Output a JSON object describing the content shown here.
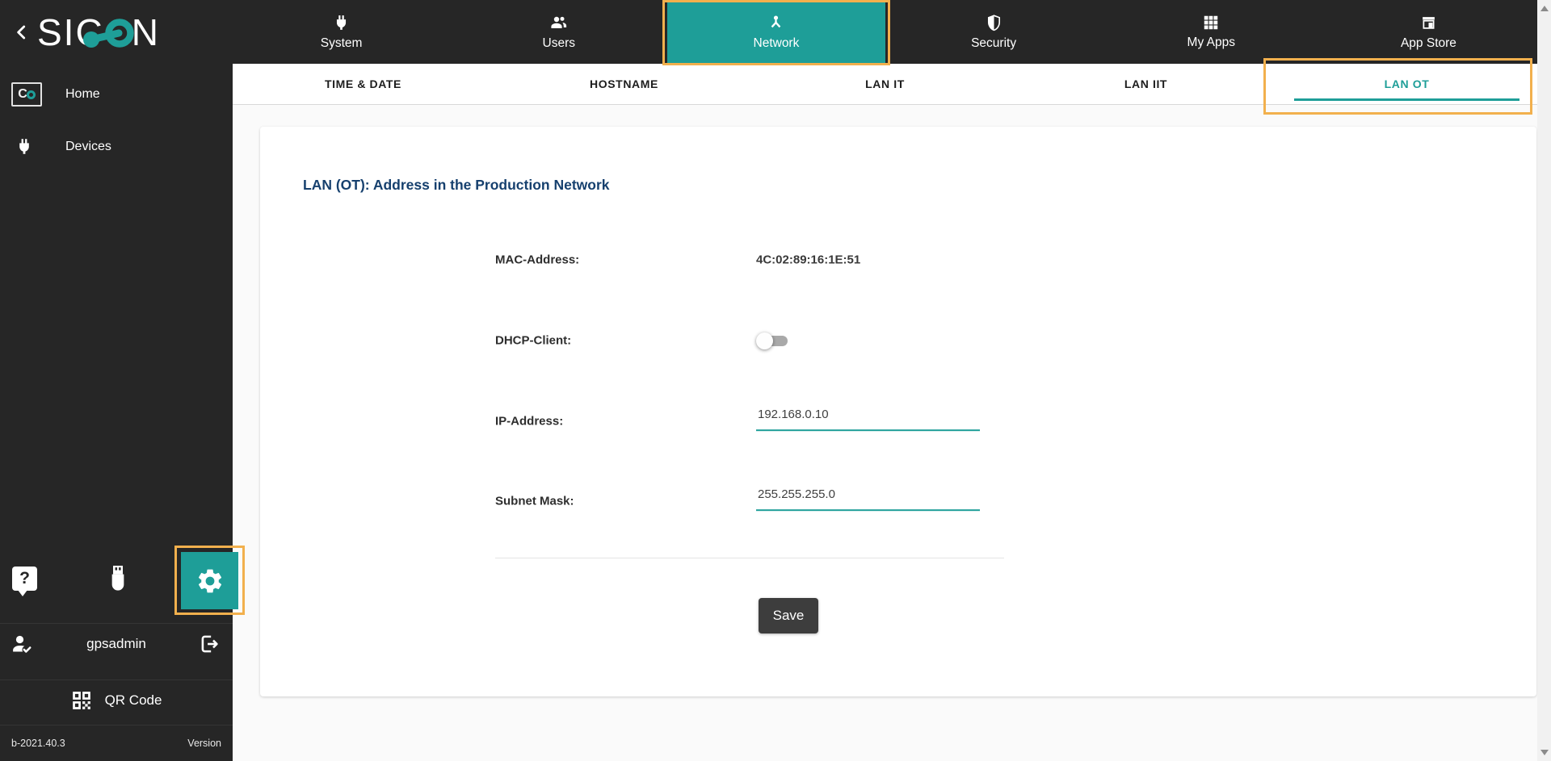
{
  "app": {
    "logo_prefix": "SIC",
    "logo_suffix": "N"
  },
  "topnav": {
    "items": [
      {
        "label": "System",
        "icon": "plug-icon",
        "active": false
      },
      {
        "label": "Users",
        "icon": "users-icon",
        "active": false
      },
      {
        "label": "Network",
        "icon": "network-icon",
        "active": true
      },
      {
        "label": "Security",
        "icon": "shield-icon",
        "active": false
      },
      {
        "label": "My Apps",
        "icon": "grid-icon",
        "active": false
      },
      {
        "label": "App Store",
        "icon": "store-icon",
        "active": false
      }
    ]
  },
  "subnav": {
    "tabs": [
      {
        "label": "TIME & DATE",
        "active": false
      },
      {
        "label": "HOSTNAME",
        "active": false
      },
      {
        "label": "LAN IT",
        "active": false
      },
      {
        "label": "LAN IIT",
        "active": false
      },
      {
        "label": "LAN OT",
        "active": true
      }
    ]
  },
  "sidebar": {
    "items": [
      {
        "label": "Home",
        "icon": "sicon-logo-mini-icon"
      },
      {
        "label": "Devices",
        "icon": "plug-icon"
      }
    ],
    "help_glyph": "?",
    "tools": [
      {
        "icon": "help-icon",
        "active": false
      },
      {
        "icon": "usb-icon",
        "active": false
      },
      {
        "icon": "settings-icon",
        "active": true
      }
    ],
    "user": {
      "name": "gpsadmin"
    },
    "qr_label": "QR Code",
    "version": {
      "build": "b-2021.40.3",
      "label": "Version"
    }
  },
  "main": {
    "title": "LAN (OT): Address in the Production Network",
    "fields": {
      "mac": {
        "label": "MAC-Address:",
        "value": "4C:02:89:16:1E:51"
      },
      "dhcp": {
        "label": "DHCP-Client:",
        "enabled": false
      },
      "ip": {
        "label": "IP-Address:",
        "value": "192.168.0.10"
      },
      "subnet": {
        "label": "Subnet Mask:",
        "value": "255.255.255.0"
      }
    },
    "save_label": "Save"
  },
  "colors": {
    "accent_teal": "#1e9e98",
    "highlight_orange": "#f2b04d",
    "title_navy": "#16406e",
    "bar_dark": "#262626",
    "save_button": "#3d3d3d"
  }
}
